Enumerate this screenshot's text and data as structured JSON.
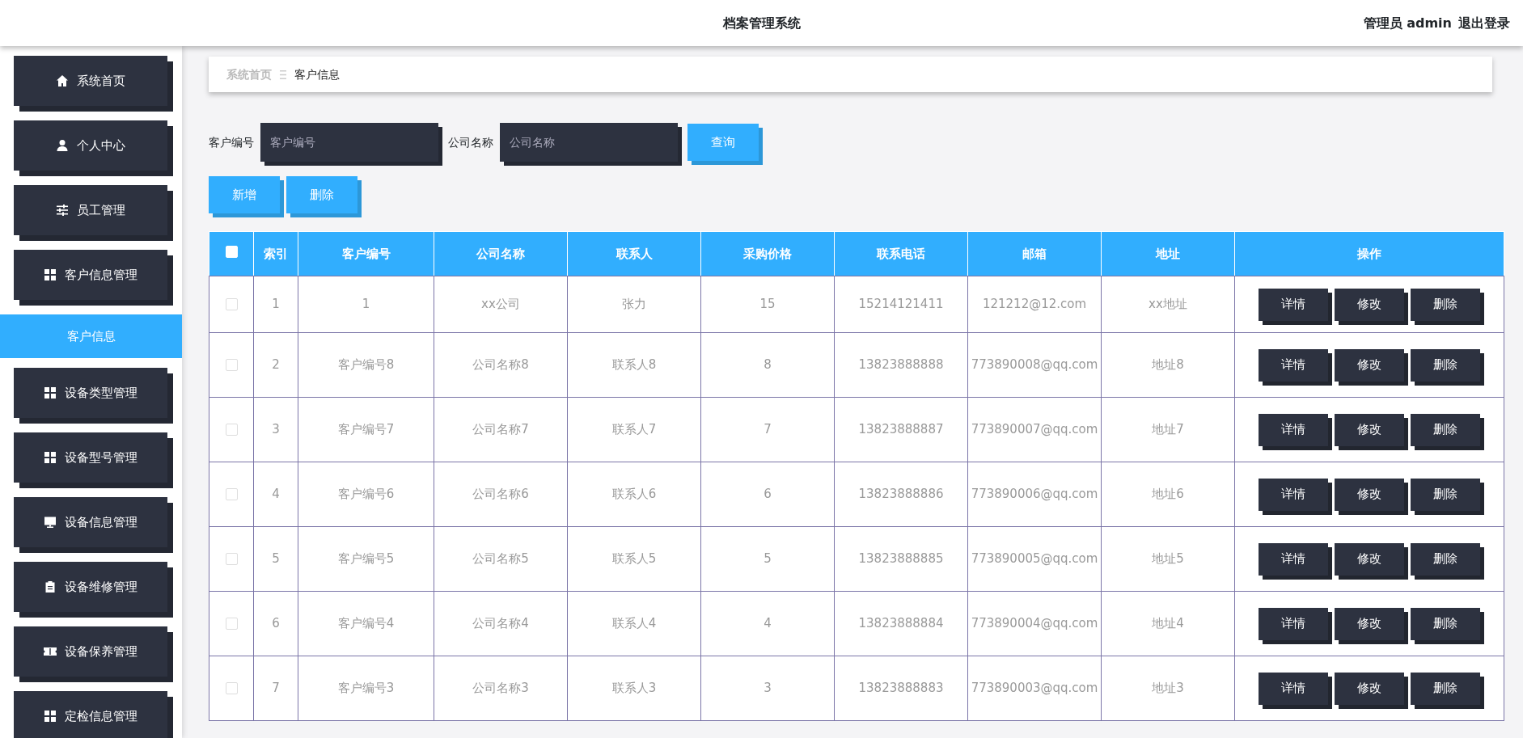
{
  "header": {
    "title": "档案管理系统",
    "user": "管理员 admin",
    "logout": "退出登录"
  },
  "sidebar": {
    "items": [
      {
        "label": "系统首页",
        "kind": "home",
        "selected": false
      },
      {
        "label": "个人中心",
        "kind": "user",
        "selected": false
      },
      {
        "label": "员工管理",
        "kind": "sliders",
        "selected": false
      },
      {
        "label": "客户信息管理",
        "kind": "grid",
        "selected": false,
        "children": [
          {
            "label": "客户信息",
            "selected": true
          }
        ]
      },
      {
        "label": "设备类型管理",
        "kind": "grid",
        "selected": false
      },
      {
        "label": "设备型号管理",
        "kind": "grid",
        "selected": false
      },
      {
        "label": "设备信息管理",
        "kind": "monitor",
        "selected": false
      },
      {
        "label": "设备维修管理",
        "kind": "clipboard",
        "selected": false
      },
      {
        "label": "设备保养管理",
        "kind": "ticket",
        "selected": false
      },
      {
        "label": "定检信息管理",
        "kind": "grid",
        "selected": false
      }
    ]
  },
  "breadcrumb": [
    "系统首页",
    "客户信息"
  ],
  "search": {
    "fields": [
      {
        "label": "客户编号",
        "placeholder": "客户编号"
      },
      {
        "label": "公司名称",
        "placeholder": "公司名称"
      }
    ],
    "button": "查询"
  },
  "actions": [
    "新增",
    "删除"
  ],
  "table": {
    "all_checked": false,
    "columns": [
      "索引",
      "客户编号",
      "公司名称",
      "联系人",
      "采购价格",
      "联系电话",
      "邮箱",
      "地址",
      "操作"
    ],
    "rows": [
      {
        "checked": false,
        "cells": [
          "1",
          "1",
          "xx公司",
          "张力",
          "15",
          "15214121411",
          "121212@12.com",
          "xx地址"
        ],
        "buttons": [
          "详情",
          "修改",
          "删除"
        ]
      },
      {
        "checked": false,
        "cells": [
          "2",
          "客户编号8",
          "公司名称8",
          "联系人8",
          "8",
          "13823888888",
          "773890008@qq.com",
          "地址8"
        ],
        "buttons": [
          "详情",
          "修改",
          "删除"
        ]
      },
      {
        "checked": false,
        "cells": [
          "3",
          "客户编号7",
          "公司名称7",
          "联系人7",
          "7",
          "13823888887",
          "773890007@qq.com",
          "地址7"
        ],
        "buttons": [
          "详情",
          "修改",
          "删除"
        ]
      },
      {
        "checked": false,
        "cells": [
          "4",
          "客户编号6",
          "公司名称6",
          "联系人6",
          "6",
          "13823888886",
          "773890006@qq.com",
          "地址6"
        ],
        "buttons": [
          "详情",
          "修改",
          "删除"
        ]
      },
      {
        "checked": false,
        "cells": [
          "5",
          "客户编号5",
          "公司名称5",
          "联系人5",
          "5",
          "13823888885",
          "773890005@qq.com",
          "地址5"
        ],
        "buttons": [
          "详情",
          "修改",
          "删除"
        ]
      },
      {
        "checked": false,
        "cells": [
          "6",
          "客户编号4",
          "公司名称4",
          "联系人4",
          "4",
          "13823888884",
          "773890004@qq.com",
          "地址4"
        ],
        "buttons": [
          "详情",
          "修改",
          "删除"
        ]
      },
      {
        "checked": false,
        "cells": [
          "7",
          "客户编号3",
          "公司名称3",
          "联系人3",
          "3",
          "13823888883",
          "773890003@qq.com",
          "地址3"
        ],
        "buttons": [
          "详情",
          "修改",
          "删除"
        ]
      }
    ]
  }
}
